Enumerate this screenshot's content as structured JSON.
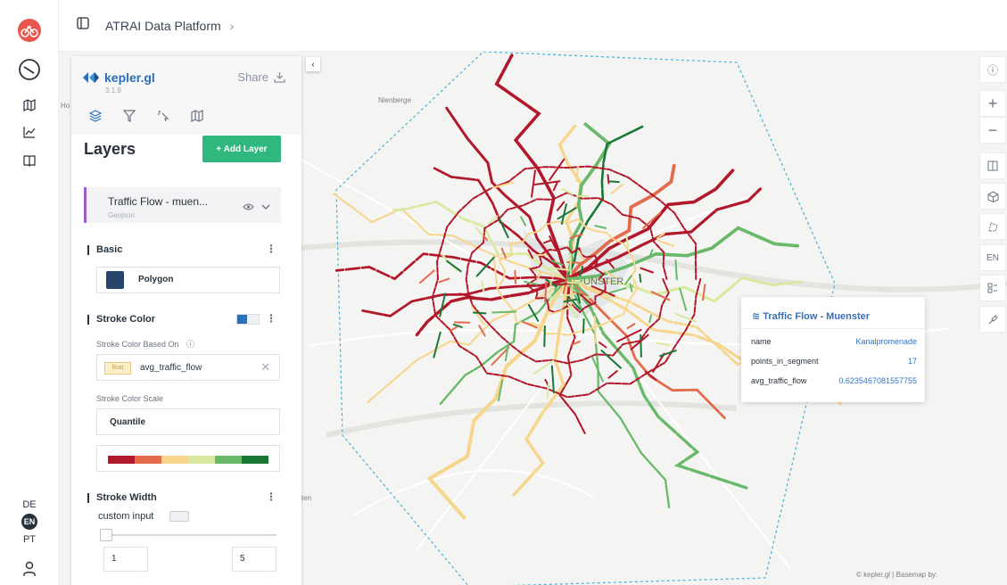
{
  "header": {
    "breadcrumb": "ATRAI Data Platform",
    "breadcrumb_chevron": "›"
  },
  "rail": {
    "icons": [
      "bike-logo-icon",
      "gauge-icon",
      "map-icon",
      "chart-icon",
      "book-icon"
    ],
    "languages": [
      "DE",
      "EN",
      "PT"
    ],
    "active_language": "EN"
  },
  "panel": {
    "logo": "kepler.gl",
    "version": "3.1.9",
    "share_label": "Share",
    "layers_title": "Layers",
    "add_layer_label": "+ Add Layer",
    "layer": {
      "name": "Traffic Flow - muen...",
      "type": "Geojson",
      "accent_color": "#a05bd0"
    },
    "basic": {
      "title": "Basic",
      "type_label": "Polygon"
    },
    "stroke_color": {
      "title": "Stroke Color",
      "based_on_label": "Stroke Color Based On",
      "field_type": "float",
      "field_name": "avg_traffic_flow",
      "scale_label": "Stroke Color Scale",
      "scale_value": "Quantile",
      "ramp": [
        "#b2182b",
        "#e26b4c",
        "#f7d58a",
        "#d9e9a0",
        "#6ab96a",
        "#1a7837"
      ]
    },
    "stroke_width": {
      "title": "Stroke Width",
      "custom_input_label": "custom input",
      "min": "1",
      "max": "5"
    }
  },
  "map": {
    "places": [
      "Nienberge",
      "Ho",
      "ten"
    ],
    "center_label": "UNSTER",
    "attribution": "© kepler.gl | Basemap by:"
  },
  "map_controls": [
    "info-icon",
    "zoom-in-icon",
    "zoom-out-icon",
    "split-map-icon",
    "3d-cube-icon",
    "draw-polygon-icon",
    "EN",
    "legend-icon",
    "brush-icon"
  ],
  "tooltip": {
    "title": "Traffic Flow - Muenster",
    "rows": [
      {
        "key": "name",
        "value": "Kanalpromenade"
      },
      {
        "key": "points_in_segment",
        "value": "17"
      },
      {
        "key": "avg_traffic_flow",
        "value": "0.6235467081557755"
      }
    ]
  }
}
